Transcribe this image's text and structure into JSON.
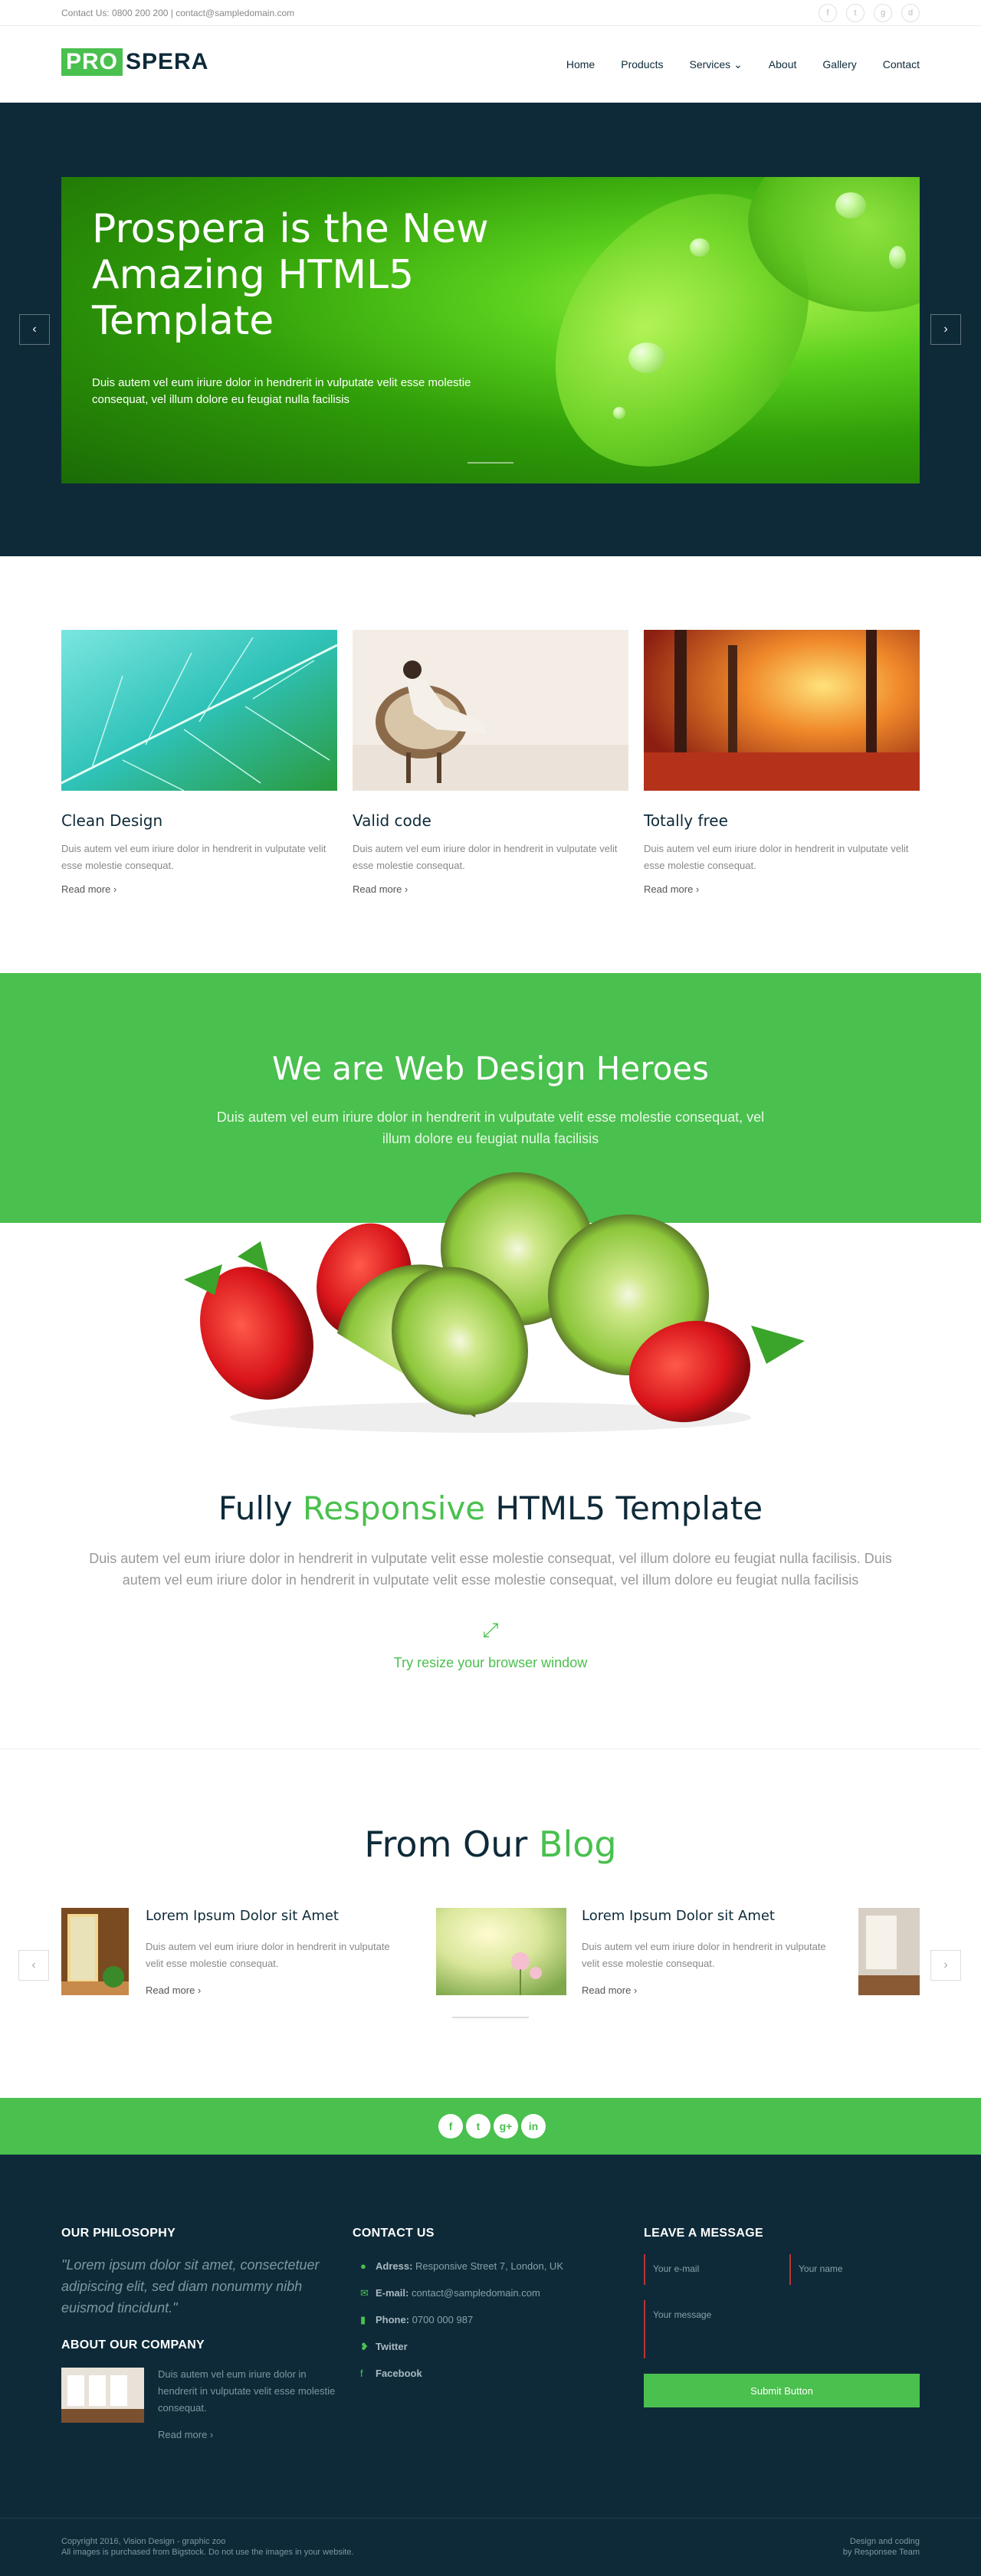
{
  "topbar": {
    "contact": "Contact Us: 0800 200 200 | contact@sampledomain.com",
    "socials": [
      {
        "icon": "facebook-icon",
        "glyph": "f"
      },
      {
        "icon": "twitter-icon",
        "glyph": "t"
      },
      {
        "icon": "google-plus-icon",
        "glyph": "g"
      },
      {
        "icon": "dribbble-icon",
        "glyph": "d"
      }
    ]
  },
  "header": {
    "logo_pro": "PRO",
    "logo_spera": "SPERA",
    "nav": [
      "Home",
      "Products",
      "Services",
      "About",
      "Gallery",
      "Contact"
    ],
    "services_chevron": "⌄"
  },
  "hero": {
    "title": "Prospera is the New Amazing HTML5 Template",
    "text": "Duis autem vel eum iriure dolor in hendrerit in vulputate velit esse molestie consequat, vel illum dolore eu feugiat nulla facilisis",
    "prev": "‹",
    "next": "›"
  },
  "features": [
    {
      "title": "Clean Design",
      "text": "Duis autem vel eum iriure dolor in hendrerit in vulputate velit esse molestie consequat.",
      "more": "Read more ›"
    },
    {
      "title": "Valid code",
      "text": "Duis autem vel eum iriure dolor in hendrerit in vulputate velit esse molestie consequat.",
      "more": "Read more ›"
    },
    {
      "title": "Totally free",
      "text": "Duis autem vel eum iriure dolor in hendrerit in vulputate velit esse molestie consequat.",
      "more": "Read more ›"
    }
  ],
  "heroes": {
    "title": "We are Web Design Heroes",
    "text": "Duis autem vel eum iriure dolor in hendrerit in vulputate velit esse molestie consequat, vel illum dolore eu feugiat nulla facilisis"
  },
  "responsive": {
    "title_a": "Fully ",
    "title_accent": "Responsive",
    "title_b": " HTML5 Template",
    "text": "Duis autem vel eum iriure dolor in hendrerit in vulputate velit esse molestie consequat, vel illum dolore eu feugiat nulla facilisis. Duis autem vel eum iriure dolor in hendrerit in vulputate velit esse molestie consequat, vel illum dolore eu feugiat nulla facilisis",
    "icon": "⤢",
    "try": "Try resize your browser window"
  },
  "blog": {
    "title_a": "From Our ",
    "title_accent": "Blog",
    "posts": [
      {
        "title": "Lorem Ipsum Dolor sit Amet",
        "text": "Duis autem vel eum iriure dolor in hendrerit in vulputate velit esse molestie consequat.",
        "more": "Read more ›"
      },
      {
        "title": "Lorem Ipsum Dolor sit Amet",
        "text": "Duis autem vel eum iriure dolor in hendrerit in vulputate velit esse molestie consequat.",
        "more": "Read more ›"
      }
    ],
    "prev": "‹",
    "next": "›"
  },
  "strip": {
    "icons": [
      "f",
      "t",
      "g+",
      "in"
    ]
  },
  "footer": {
    "philosophy_title": "OUR PHILOSOPHY",
    "philosophy_quote": "\"Lorem ipsum dolor sit amet, consectetuer adipiscing elit, sed diam nonummy nibh euismod tincidunt.\"",
    "about_title": "ABOUT OUR COMPANY",
    "about_text": "Duis autem vel eum iriure dolor in hendrerit in vulputate velit esse molestie consequat.",
    "about_more": "Read more ›",
    "contact_title": "CONTACT US",
    "contact": [
      {
        "key": "Adress:",
        "value": " Responsive Street 7, London, UK",
        "glyph": "●"
      },
      {
        "key": "E-mail:",
        "value": " contact@sampledomain.com",
        "glyph": "✉"
      },
      {
        "key": "Phone:",
        "value": " 0700 000 987",
        "glyph": "▮"
      },
      {
        "key": "Twitter",
        "value": "",
        "glyph": "❥"
      },
      {
        "key": "Facebook",
        "value": "",
        "glyph": "f"
      }
    ],
    "message_title": "LEAVE A MESSAGE",
    "email_placeholder": "Your e-mail",
    "name_placeholder": "Your name",
    "message_placeholder": "Your message",
    "submit": "Submit Button",
    "copyright_1": "Copyright 2016, Vision Design - graphic zoo",
    "copyright_2": "All images is purchased from Bigstock. Do not use the images in your website.",
    "credit_1": "Design and coding",
    "credit_2": "by Responsee Team"
  },
  "colors": {
    "accent": "#4ac04e",
    "navy": "#0e2a39"
  }
}
